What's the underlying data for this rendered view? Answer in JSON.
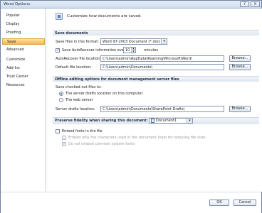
{
  "window": {
    "title": "Word Options"
  },
  "titlebar": {
    "help_label": "?",
    "close_label": "×"
  },
  "sidebar": {
    "items": [
      {
        "label": "Popular"
      },
      {
        "label": "Display"
      },
      {
        "label": "Proofing"
      },
      {
        "label": "Save",
        "active": true
      },
      {
        "label": "Advanced"
      },
      {
        "label": "Customize"
      },
      {
        "label": "Add-Ins"
      },
      {
        "label": "Trust Center"
      },
      {
        "label": "Resources"
      }
    ]
  },
  "header": {
    "text": "Customize how documents are saved."
  },
  "save_documents": {
    "title": "Save documents",
    "format_label": "Save files in this format:",
    "format_value": "Word 97-2003 Document (*.doc)",
    "autorecover_label": "Save AutoRecover information every",
    "autorecover_checked": true,
    "autorecover_minutes": "10",
    "minutes_label": "minutes",
    "autorecover_location_label": "AutoRecover file location:",
    "autorecover_location_value": "C:\\Users\\admin\\AppData\\Roaming\\Microsoft\\Word\\",
    "default_location_label": "Default file location:",
    "default_location_value": "C:\\Users\\admin\\Documents\\",
    "browse_label": "Browse..."
  },
  "offline": {
    "title": "Offline editing options for document management server files",
    "checkout_label": "Save checked-out files to:",
    "option_server_drafts": "The server drafts location on this computer",
    "option_web_server": "The web server",
    "server_drafts_label": "Server drafts location:",
    "server_drafts_value": "C:\\Users\\admin\\Documents\\SharePoint Drafts\\",
    "browse_label": "Browse..."
  },
  "fidelity": {
    "title": "Preserve fidelity when sharing this document:",
    "document_value": "Document1",
    "embed_fonts_label": "Embed fonts in the file",
    "embed_only_used_label": "Embed only the characters used in the document (best for reducing file size)",
    "no_common_fonts_label": "Do not embed common system fonts"
  },
  "footer": {
    "ok_label": "OK",
    "cancel_label": "Cancel"
  }
}
